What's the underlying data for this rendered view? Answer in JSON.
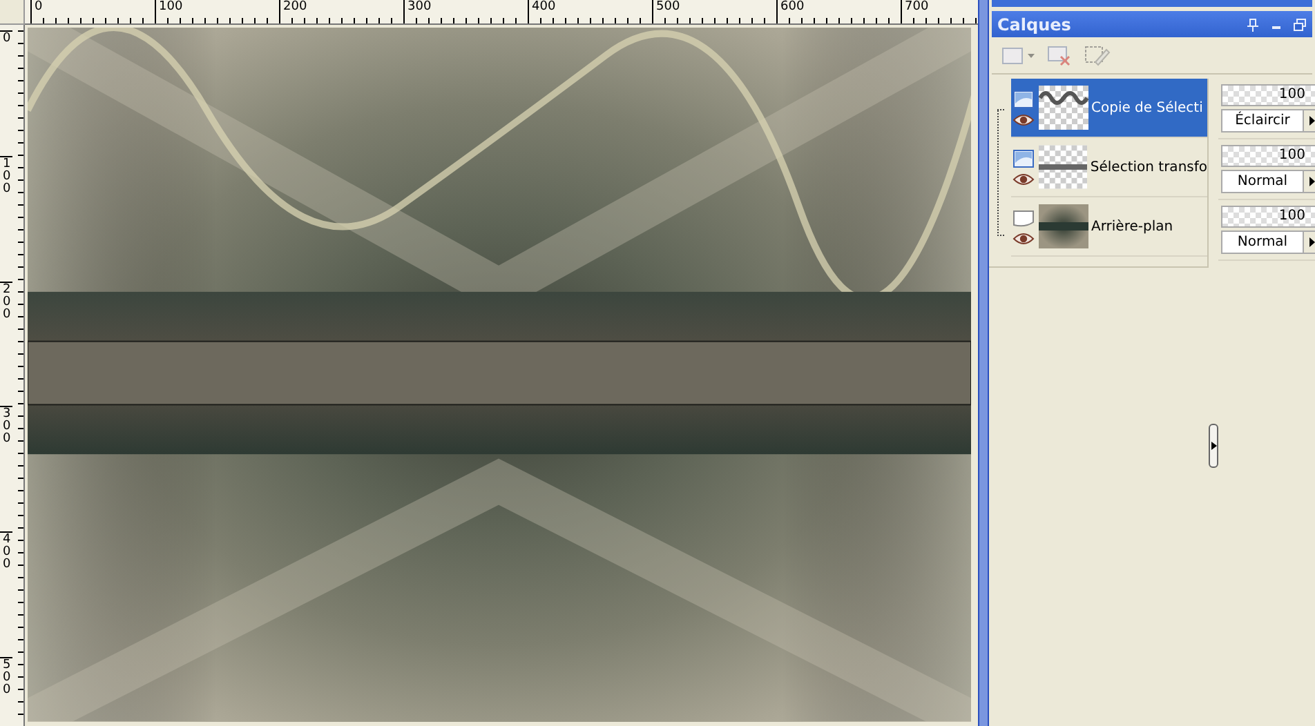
{
  "rulers": {
    "horizontal": [
      "0",
      "100",
      "200",
      "300",
      "400",
      "500",
      "600",
      "700"
    ],
    "vertical": [
      "0",
      "100",
      "200",
      "300",
      "400",
      "500"
    ]
  },
  "panel": {
    "title": "Calques"
  },
  "layers": [
    {
      "name": "Copie de Sélecti",
      "kind": "raster",
      "selected": true,
      "visible": true,
      "opacity": "100",
      "level": 1,
      "blend_mode": "Éclaircir"
    },
    {
      "name": "Sélection transfo",
      "kind": "raster",
      "selected": false,
      "visible": true,
      "opacity": "100",
      "level": 1,
      "blend_mode": "Normal"
    },
    {
      "name": "Arrière-plan",
      "kind": "background",
      "selected": false,
      "visible": true,
      "opacity": "100",
      "level": 1,
      "blend_mode": "Normal"
    }
  ]
}
